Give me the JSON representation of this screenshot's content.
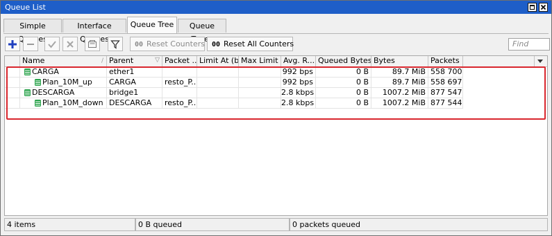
{
  "window": {
    "title": "Queue List"
  },
  "tabs": [
    {
      "label": "Simple Queues",
      "active": false
    },
    {
      "label": "Interface Queues",
      "active": false
    },
    {
      "label": "Queue Tree",
      "active": true
    },
    {
      "label": "Queue Types",
      "active": false
    }
  ],
  "toolbar": {
    "reset_counters_label": "Reset Counters",
    "reset_all_counters_label": "Reset All Counters",
    "counter_glyph": "00",
    "find_placeholder": "Find"
  },
  "table": {
    "columns": [
      "Name",
      "Parent",
      "Packet ...",
      "Limit At (b...",
      "Max Limit ...",
      "Avg. R...",
      "Queued Bytes",
      "Bytes",
      "Packets"
    ],
    "rows": [
      {
        "name": "CARGA",
        "parent": "ether1",
        "packet_mark": "",
        "limit_at": "",
        "max_limit": "",
        "avg_rate": "992 bps",
        "queued_bytes": "0 B",
        "bytes": "89.7 MiB",
        "packets": "558 700"
      },
      {
        "name": "Plan_10M_up",
        "parent": "CARGA",
        "packet_mark": "resto_P...",
        "limit_at": "",
        "max_limit": "",
        "avg_rate": "992 bps",
        "queued_bytes": "0 B",
        "bytes": "89.7 MiB",
        "packets": "558 697"
      },
      {
        "name": "DESCARGA",
        "parent": "bridge1",
        "packet_mark": "",
        "limit_at": "",
        "max_limit": "",
        "avg_rate": "2.8 kbps",
        "queued_bytes": "0 B",
        "bytes": "1007.2 MiB",
        "packets": "877 547"
      },
      {
        "name": "Plan_10M_down",
        "parent": "DESCARGA",
        "packet_mark": "resto_P...",
        "limit_at": "",
        "max_limit": "",
        "avg_rate": "2.8 kbps",
        "queued_bytes": "0 B",
        "bytes": "1007.2 MiB",
        "packets": "877 544"
      }
    ]
  },
  "status": {
    "items": "4 items",
    "queued": "0 B queued",
    "packets_queued": "0 packets queued"
  },
  "colors": {
    "titlebar": "#1e5ec8",
    "highlight": "#d9262d",
    "queue_icon": "#2da44e",
    "add_icon": "#1f3fbf"
  }
}
